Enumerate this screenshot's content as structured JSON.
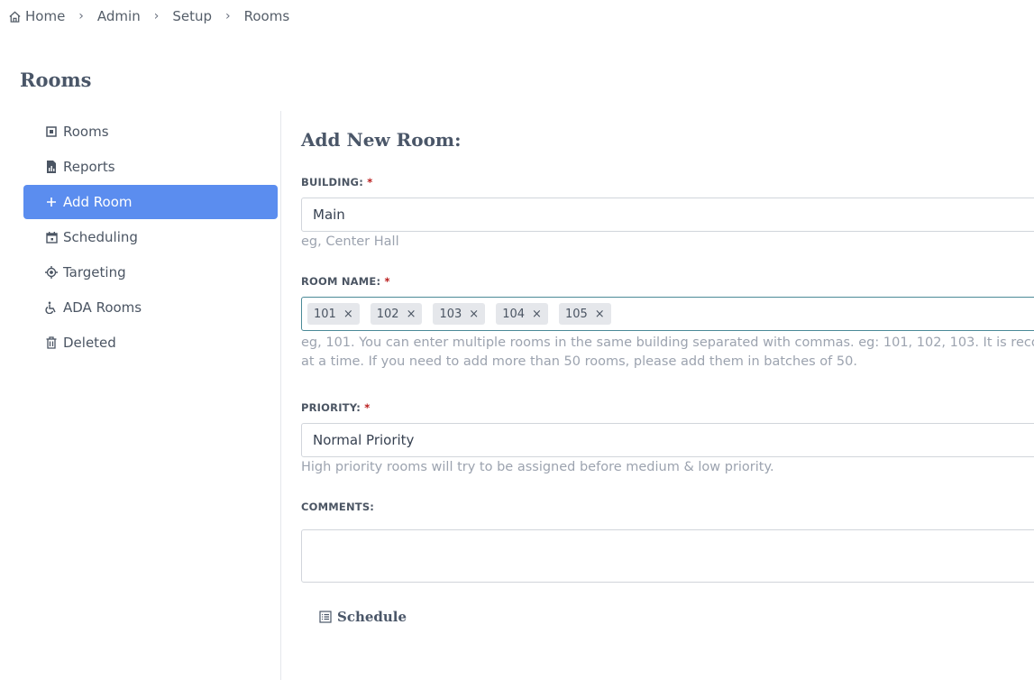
{
  "breadcrumb": {
    "items": [
      "Home",
      "Admin",
      "Setup",
      "Rooms"
    ]
  },
  "page_title": "Rooms",
  "sidebar": {
    "items": [
      {
        "label": "Rooms",
        "icon": "square-dot-icon"
      },
      {
        "label": "Reports",
        "icon": "report-file-icon"
      },
      {
        "label": "Add Room",
        "icon": "plus-icon",
        "active": true
      },
      {
        "label": "Scheduling",
        "icon": "calendar-icon"
      },
      {
        "label": "Targeting",
        "icon": "target-icon"
      },
      {
        "label": "ADA Rooms",
        "icon": "accessibility-icon"
      },
      {
        "label": "Deleted",
        "icon": "trash-icon"
      }
    ]
  },
  "form": {
    "title": "Add New Room:",
    "building": {
      "label": "BUILDING:",
      "required": "*",
      "value": "Main",
      "hint": "eg, Center Hall"
    },
    "room_name": {
      "label": "ROOM NAME:",
      "required": "*",
      "tags": [
        "101",
        "102",
        "103",
        "104",
        "105"
      ],
      "remove_glyph": "×",
      "hint_line1": "eg, 101. You can enter multiple rooms in the same building separated with commas. eg: 101, 102, 103. It is recommer",
      "hint_line2": "at a time. If you need to add more than 50 rooms, please add them in batches of 50."
    },
    "priority": {
      "label": "PRIORITY:",
      "required": "*",
      "value": "Normal Priority",
      "hint": "High priority rooms will try to be assigned before medium & low priority."
    },
    "comments": {
      "label": "COMMENTS:",
      "value": ""
    },
    "schedule_label": "Schedule"
  },
  "colors": {
    "accent": "#5b8def",
    "required": "#b91c1c",
    "focus_border": "#4b8a98"
  }
}
